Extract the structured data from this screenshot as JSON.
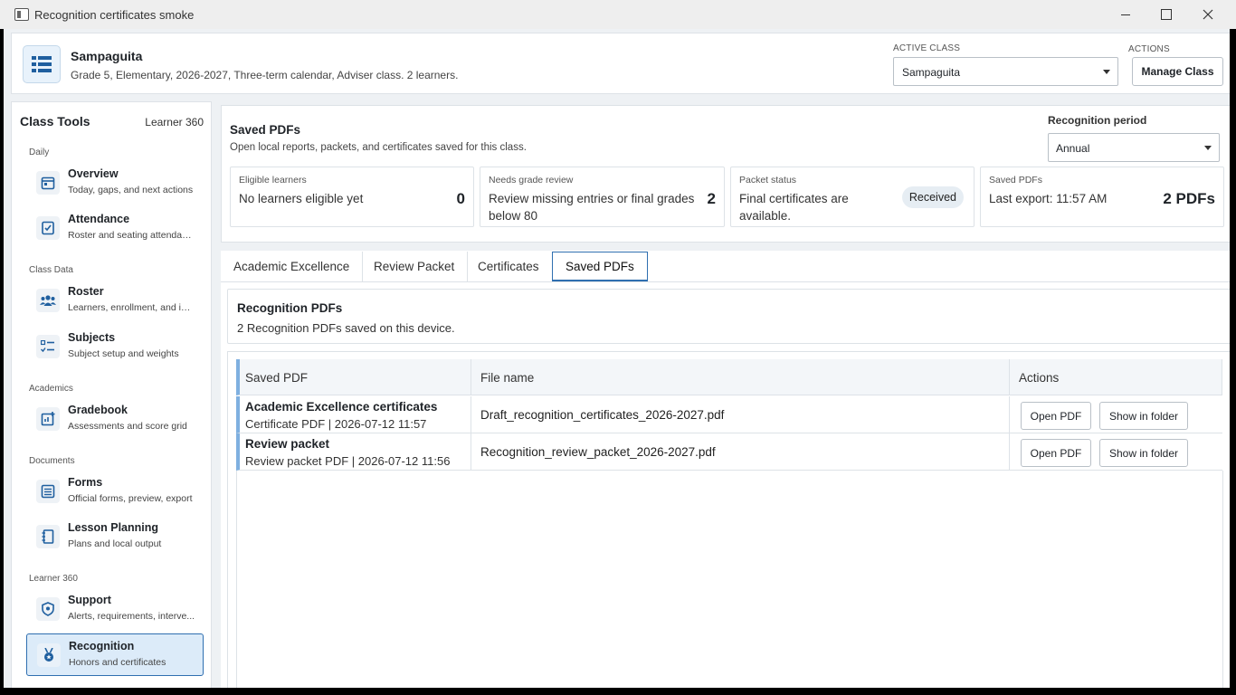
{
  "window": {
    "title": "Recognition certificates smoke"
  },
  "header": {
    "class_name": "Sampaguita",
    "class_desc": "Grade 5, Elementary, 2026-2027, Three-term calendar, Adviser class. 2 learners.",
    "active_class_label": "ACTIVE CLASS",
    "active_class_value": "Sampaguita",
    "actions_label": "ACTIONS",
    "manage_button": "Manage Class"
  },
  "sidebar": {
    "title": "Class Tools",
    "right_label": "Learner 360",
    "sections": [
      "Daily",
      "Class Data",
      "Academics",
      "Documents",
      "Learner 360"
    ],
    "items": [
      {
        "label": "Overview",
        "sub": "Today, gaps, and next actions",
        "icon": "calendar-icon"
      },
      {
        "label": "Attendance",
        "sub": "Roster and seating attendance",
        "icon": "attendance-icon"
      },
      {
        "label": "Roster",
        "sub": "Learners, enrollment, and im...",
        "icon": "people-icon"
      },
      {
        "label": "Subjects",
        "sub": "Subject setup and weights",
        "icon": "checklist-icon"
      },
      {
        "label": "Gradebook",
        "sub": "Assessments and score grid",
        "icon": "gradebook-icon"
      },
      {
        "label": "Forms",
        "sub": "Official forms, preview, export",
        "icon": "list-icon"
      },
      {
        "label": "Lesson Planning",
        "sub": "Plans and local output",
        "icon": "notebook-icon"
      },
      {
        "label": "Support",
        "sub": "Alerts, requirements, interve...",
        "icon": "shield-icon"
      },
      {
        "label": "Recognition",
        "sub": "Honors and certificates",
        "icon": "medal-icon"
      }
    ]
  },
  "summary": {
    "title": "Saved PDFs",
    "subtitle": "Open local reports, packets, and certificates saved for this class.",
    "period_label": "Recognition period",
    "period_value": "Annual",
    "cards": [
      {
        "label": "Eligible learners",
        "text": "No learners eligible yet",
        "value": "0"
      },
      {
        "label": "Needs grade review",
        "text": "Review missing entries or final grades below 80",
        "value": "2"
      },
      {
        "label": "Packet status",
        "text": "Final certificates are available.",
        "badge": "Received"
      },
      {
        "label": "Saved PDFs",
        "text": "Last export: 11:57 AM",
        "value": "2 PDFs"
      }
    ]
  },
  "tabs": [
    "Academic Excellence",
    "Review Packet",
    "Certificates",
    "Saved PDFs"
  ],
  "recognition": {
    "title": "Recognition PDFs",
    "subtitle": "2 Recognition PDFs saved on this device."
  },
  "table": {
    "headers": [
      "Saved PDF",
      "File name",
      "Actions"
    ],
    "rows": [
      {
        "title": "Academic Excellence certificates",
        "sub": "Certificate PDF | 2026-07-12 11:57",
        "file": "Draft_recognition_certificates_2026-2027.pdf",
        "open": "Open PDF",
        "show": "Show in folder"
      },
      {
        "title": "Review packet",
        "sub": "Review packet PDF | 2026-07-12 11:56",
        "file": "Recognition_review_packet_2026-2027.pdf",
        "open": "Open PDF",
        "show": "Show in folder"
      }
    ]
  },
  "colors": {
    "accent": "#2f6fb0",
    "active_bg": "#dcebf9",
    "row_marker": "#7fb0e0"
  }
}
